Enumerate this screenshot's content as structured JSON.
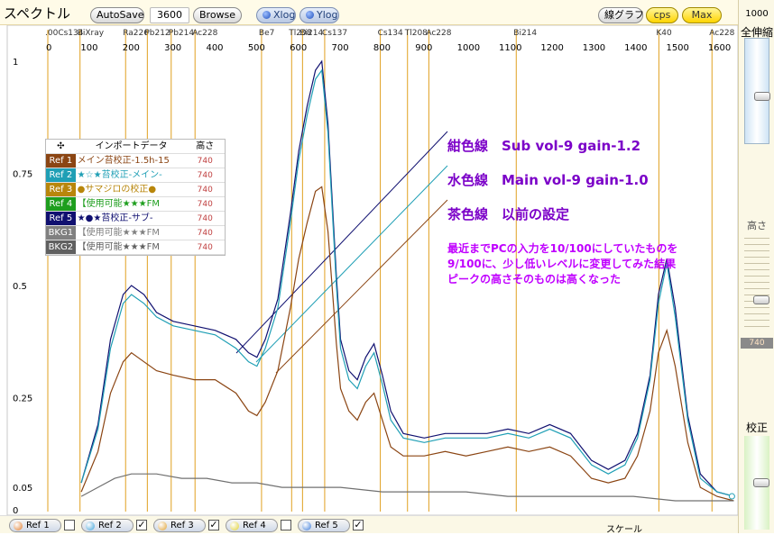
{
  "app": {
    "title": "スペクトル"
  },
  "toolbar": {
    "autosave_label": "AutoSave",
    "time_value": "3600",
    "browse_label": "Browse",
    "xlog_label": "Xlog",
    "ylog_label": "Ylog",
    "graph_label": "線グラフ",
    "cps_label": "cps",
    "max_label": "Max"
  },
  "right_panel": {
    "max_value": "1000",
    "zoom_label": "全伸縮",
    "height_label": "高さ",
    "height_value": "740",
    "calib_label": "校正",
    "zoom_level": 0.55,
    "height_level": 0.7,
    "calib_level": 0.5
  },
  "reftable": {
    "header": {
      "icon": "✣",
      "import_label": "インポートデータ",
      "height_label": "高さ"
    },
    "rows": [
      {
        "tag": "Ref 1",
        "name": "メイン苔校正-1.5h-15",
        "value": "740",
        "color": "#8b4513"
      },
      {
        "tag": "Ref 2",
        "name": "★☆★苔校正-メイン-",
        "value": "740",
        "color": "#1f9fb5"
      },
      {
        "tag": "Ref 3",
        "name": "●サマジロの校正●",
        "value": "740",
        "color": "#b8860b"
      },
      {
        "tag": "Ref 4",
        "name": "【使用可能★★★FM",
        "value": "740",
        "color": "#1e9e1e"
      },
      {
        "tag": "Ref 5",
        "name": "★●★苔校正-サブ-",
        "value": "740",
        "color": "#101070"
      },
      {
        "tag": "BKG1",
        "name": "【使用可能★★★FM",
        "value": "740",
        "color": "#808080"
      },
      {
        "tag": "BKG2",
        "name": "【使用可能★★★FM",
        "value": "740",
        "color": "#606060"
      }
    ]
  },
  "annotations": {
    "navy_line": "紺色線　Sub  vol-9  gain-1.2",
    "cyan_line": "水色線　Main vol-9  gain-1.0",
    "brown_line": "茶色線　以前の設定",
    "note_1": "最近までPCの入力を10/100にしていたものを",
    "note_2": "9/100に、少し低いレベルに変更してみた結果",
    "note_3": "ピークの高さそのものは高くなった"
  },
  "bottom_bar": {
    "tabs": [
      {
        "label": "Ref 1",
        "checked": false,
        "ball": "#e07a2a"
      },
      {
        "label": "Ref 2",
        "checked": true,
        "ball": "#3aa0d8"
      },
      {
        "label": "Ref 3",
        "checked": true,
        "ball": "#e0a030"
      },
      {
        "label": "Ref 4",
        "checked": false,
        "ball": "#e0d030"
      },
      {
        "label": "Ref 5",
        "checked": true,
        "ball": "#3a7ad8"
      }
    ],
    "scale_label": "スケール"
  },
  "chart_data": {
    "type": "line",
    "xlim": [
      0,
      1650
    ],
    "ylim": [
      0,
      1
    ],
    "x_ticks": [
      0,
      100,
      200,
      300,
      400,
      500,
      600,
      700,
      800,
      900,
      1000,
      1100,
      1200,
      1300,
      1400,
      1500,
      1600
    ],
    "y_ticks": [
      {
        "value": 1,
        "label": "1"
      },
      {
        "value": 0.75,
        "label": "0.75"
      },
      {
        "value": 0.5,
        "label": "0.5"
      },
      {
        "value": 0.25,
        "label": "0.25"
      },
      {
        "value": 0.05,
        "label": "0.05"
      },
      {
        "value": 0,
        "label": "0"
      }
    ],
    "peak_markers": [
      {
        "x": 0,
        "label": ".00Cs134"
      },
      {
        "x": 77,
        "label": "BiXray"
      },
      {
        "x": 186,
        "label": "Ra226"
      },
      {
        "x": 238,
        "label": "Pb212"
      },
      {
        "x": 295,
        "label": "Pb214"
      },
      {
        "x": 352,
        "label": "Ac228"
      },
      {
        "x": 511,
        "label": "Be7"
      },
      {
        "x": 583,
        "label": "Tl208"
      },
      {
        "x": 609,
        "label": "Bi214"
      },
      {
        "x": 662,
        "label": "Cs137"
      },
      {
        "x": 795,
        "label": "Cs134"
      },
      {
        "x": 860,
        "label": "Tl208"
      },
      {
        "x": 911,
        "label": "Ac228"
      },
      {
        "x": 1120,
        "label": "Bi214"
      },
      {
        "x": 1461,
        "label": "K40"
      },
      {
        "x": 1588,
        "label": "Ac228"
      }
    ],
    "series": [
      {
        "color": "#101070",
        "x": [
          80,
          120,
          150,
          180,
          200,
          230,
          260,
          300,
          350,
          400,
          450,
          480,
          500,
          520,
          550,
          580,
          600,
          620,
          640,
          655,
          670,
          690,
          700,
          720,
          740,
          760,
          780,
          800,
          820,
          850,
          900,
          950,
          1000,
          1050,
          1100,
          1150,
          1200,
          1250,
          1300,
          1340,
          1380,
          1410,
          1440,
          1460,
          1480,
          1500,
          1530,
          1560,
          1600,
          1640
        ],
        "y": [
          0.06,
          0.19,
          0.38,
          0.48,
          0.5,
          0.48,
          0.44,
          0.42,
          0.41,
          0.4,
          0.38,
          0.35,
          0.34,
          0.38,
          0.47,
          0.66,
          0.8,
          0.9,
          0.98,
          1.0,
          0.86,
          0.52,
          0.38,
          0.31,
          0.29,
          0.34,
          0.37,
          0.3,
          0.22,
          0.17,
          0.16,
          0.17,
          0.17,
          0.17,
          0.18,
          0.17,
          0.19,
          0.17,
          0.11,
          0.09,
          0.11,
          0.17,
          0.3,
          0.48,
          0.56,
          0.45,
          0.21,
          0.08,
          0.04,
          0.03
        ]
      },
      {
        "color": "#1f9fb5",
        "x": [
          80,
          120,
          150,
          180,
          200,
          230,
          260,
          300,
          350,
          400,
          450,
          480,
          500,
          520,
          550,
          580,
          600,
          620,
          640,
          655,
          670,
          690,
          700,
          720,
          740,
          760,
          780,
          800,
          820,
          850,
          900,
          950,
          1000,
          1050,
          1100,
          1150,
          1200,
          1250,
          1300,
          1340,
          1380,
          1410,
          1440,
          1460,
          1480,
          1500,
          1530,
          1560,
          1600,
          1640
        ],
        "y": [
          0.06,
          0.18,
          0.36,
          0.46,
          0.48,
          0.46,
          0.43,
          0.41,
          0.4,
          0.39,
          0.36,
          0.33,
          0.32,
          0.36,
          0.45,
          0.64,
          0.78,
          0.88,
          0.96,
          0.98,
          0.84,
          0.5,
          0.36,
          0.29,
          0.27,
          0.32,
          0.35,
          0.28,
          0.2,
          0.16,
          0.15,
          0.16,
          0.16,
          0.16,
          0.17,
          0.16,
          0.18,
          0.16,
          0.1,
          0.08,
          0.1,
          0.16,
          0.29,
          0.46,
          0.55,
          0.43,
          0.2,
          0.07,
          0.04,
          0.03
        ]
      },
      {
        "color": "#8b4513",
        "x": [
          80,
          120,
          150,
          180,
          200,
          230,
          260,
          300,
          350,
          400,
          450,
          480,
          500,
          520,
          550,
          580,
          600,
          620,
          640,
          655,
          670,
          690,
          700,
          720,
          740,
          760,
          780,
          800,
          820,
          850,
          900,
          950,
          1000,
          1050,
          1100,
          1150,
          1200,
          1250,
          1300,
          1340,
          1380,
          1410,
          1440,
          1460,
          1480,
          1500,
          1530,
          1560,
          1600,
          1640
        ],
        "y": [
          0.04,
          0.13,
          0.26,
          0.33,
          0.35,
          0.33,
          0.31,
          0.3,
          0.29,
          0.29,
          0.26,
          0.22,
          0.21,
          0.24,
          0.31,
          0.45,
          0.56,
          0.64,
          0.71,
          0.72,
          0.62,
          0.37,
          0.27,
          0.22,
          0.2,
          0.24,
          0.26,
          0.2,
          0.14,
          0.12,
          0.12,
          0.13,
          0.12,
          0.13,
          0.14,
          0.13,
          0.14,
          0.12,
          0.07,
          0.06,
          0.07,
          0.12,
          0.22,
          0.35,
          0.4,
          0.32,
          0.15,
          0.05,
          0.03,
          0.02
        ]
      },
      {
        "color": "#707070",
        "x": [
          80,
          120,
          160,
          200,
          260,
          320,
          380,
          440,
          500,
          560,
          620,
          700,
          800,
          900,
          1000,
          1100,
          1200,
          1300,
          1400,
          1500,
          1600,
          1640
        ],
        "y": [
          0.03,
          0.05,
          0.07,
          0.08,
          0.08,
          0.07,
          0.07,
          0.06,
          0.06,
          0.05,
          0.05,
          0.05,
          0.04,
          0.04,
          0.04,
          0.03,
          0.03,
          0.03,
          0.03,
          0.02,
          0.02,
          0.02
        ]
      }
    ]
  }
}
